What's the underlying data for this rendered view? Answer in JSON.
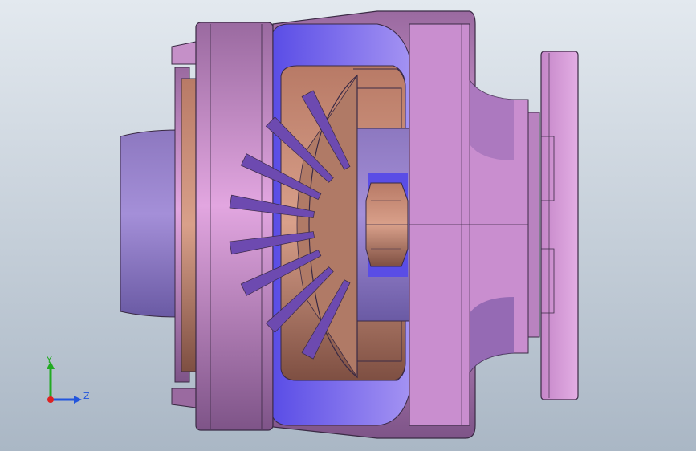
{
  "viewport": {
    "background_top": "#e3e9ef",
    "background_bottom": "#aab7c5"
  },
  "model": {
    "body_color": "#d79bd6",
    "body_shade": "#8f5f98",
    "highlight_color": "#7a6cf0",
    "copper_color": "#c68a72",
    "copper_shade": "#8a5a4a",
    "edge_color": "#2a1a2e"
  },
  "triad": {
    "y_label": "Y",
    "z_label": "Z",
    "y_color": "#22aa22",
    "z_color": "#2255dd",
    "x_color": "#dd2222"
  }
}
